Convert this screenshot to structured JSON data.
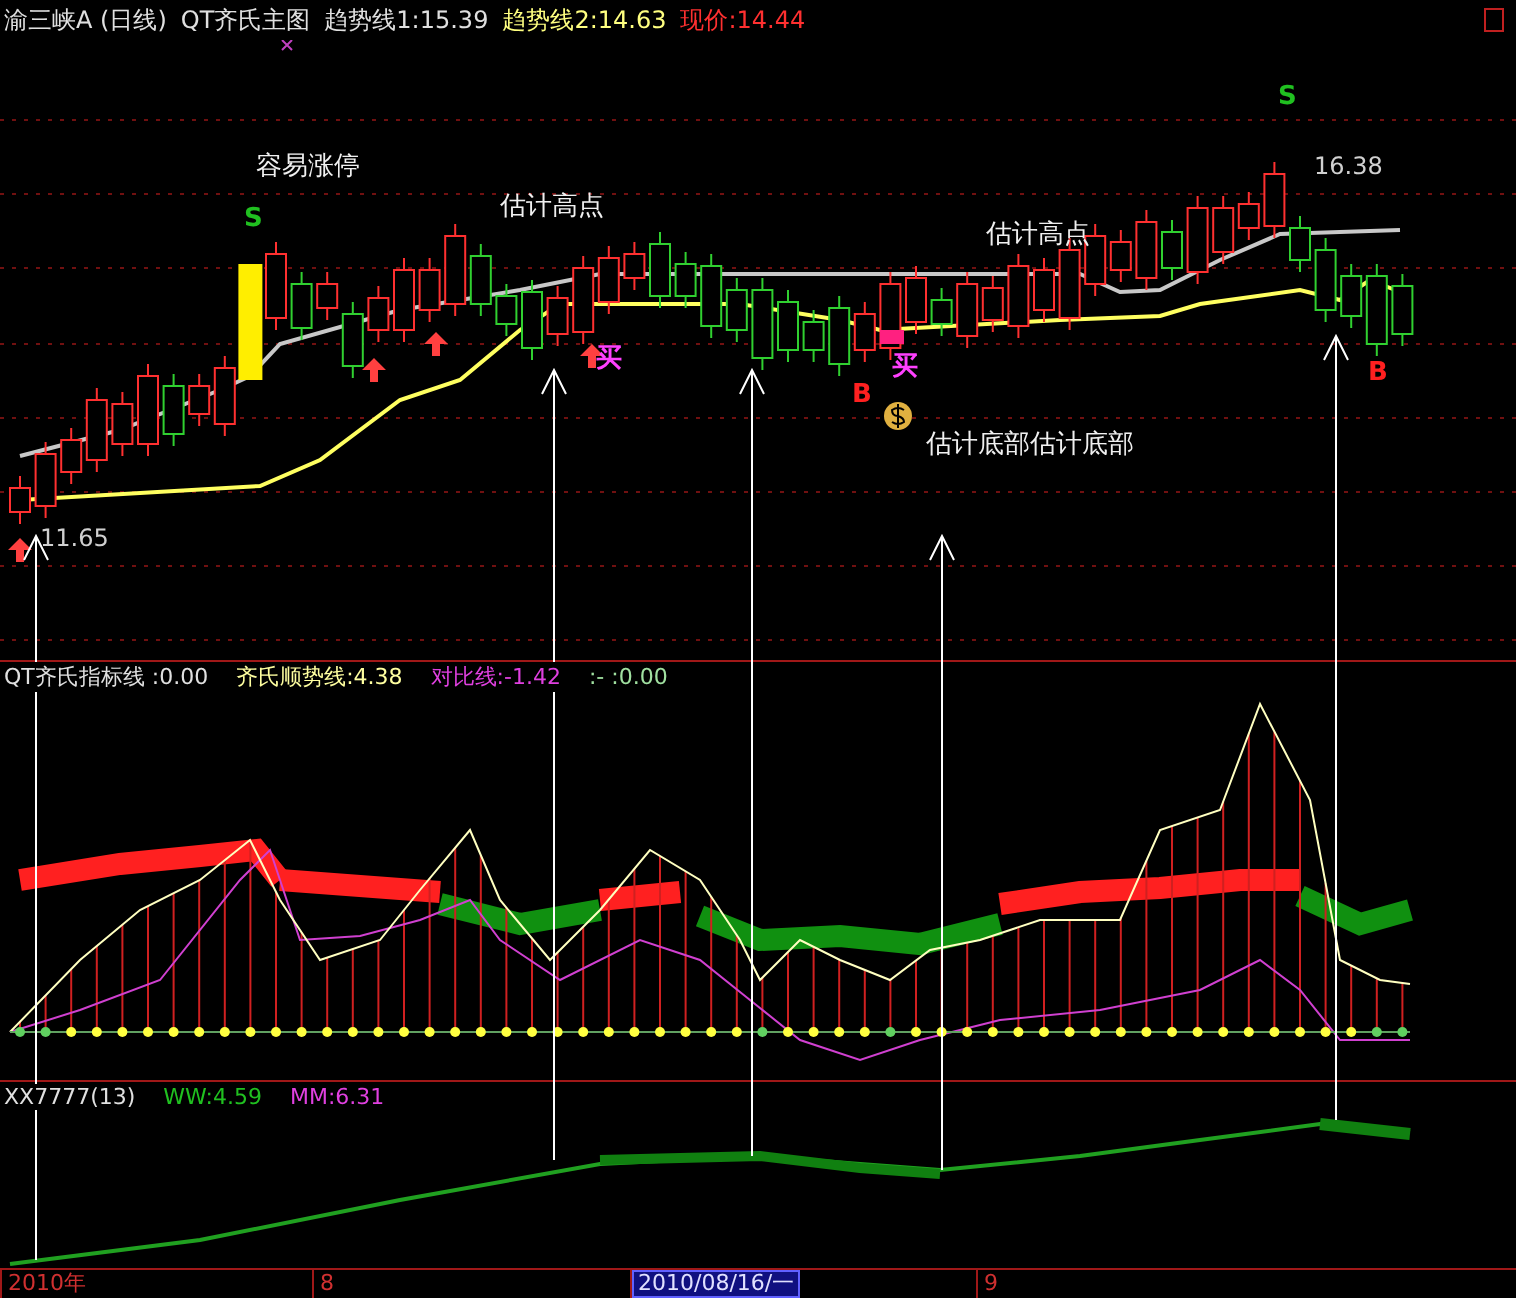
{
  "header": [
    {
      "text": "渝三峡A (日线)",
      "color": "#e0e0e0"
    },
    {
      "text": "QT齐氏主图",
      "color": "#e0e0e0"
    },
    {
      "text": "趋势线1:15.39",
      "color": "#e0e0e0"
    },
    {
      "text": "趋势线2:14.63",
      "color": "#ffff80"
    },
    {
      "text": "现价:14.44",
      "color": "#ff3030"
    }
  ],
  "main_chart": {
    "annotations": [
      "容易涨停",
      "估计高点",
      "估计高点",
      "估计底部估计底部"
    ],
    "price_labels": [
      "16.38",
      "11.65"
    ],
    "markers": [
      {
        "text": "S",
        "color": "#20c020"
      },
      {
        "text": "S",
        "color": "#20c020"
      },
      {
        "text": "B",
        "color": "#ff2020"
      },
      {
        "text": "B",
        "color": "#ff2020"
      },
      {
        "text": "买",
        "color": "#ff40ff"
      },
      {
        "text": "买",
        "color": "#ff40ff"
      }
    ]
  },
  "indicator_panel": {
    "legend": [
      {
        "text": "QT齐氏指标线 :0.00",
        "color": "#e0e0e0"
      },
      {
        "text": "齐氏顺势线:4.38",
        "color": "#ffffa0"
      },
      {
        "text": "对比线:-1.42",
        "color": "#e040e0"
      },
      {
        "text": ":- :0.00",
        "color": "#a0e0a0"
      }
    ]
  },
  "volume_panel": {
    "legend": [
      {
        "text": "XX7777(13)",
        "color": "#e0e0e0"
      },
      {
        "text": "WW:4.59",
        "color": "#20c020"
      },
      {
        "text": "MM:6.31",
        "color": "#e040e0"
      }
    ]
  },
  "date_axis": [
    {
      "label": "2010年",
      "selected": false
    },
    {
      "label": "8",
      "selected": false
    },
    {
      "label": "2010/08/16/一",
      "selected": true
    },
    {
      "label": "9",
      "selected": false
    }
  ]
}
